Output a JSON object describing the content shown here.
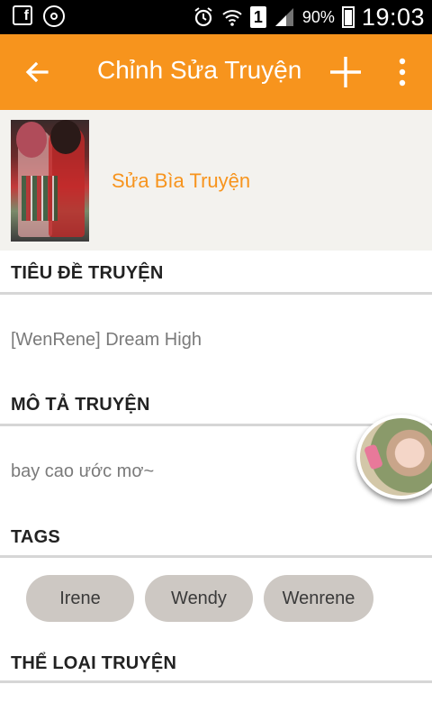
{
  "status_bar": {
    "facebook_icon": "facebook-icon",
    "browser_icon": "chrome-icon",
    "alarm_icon": "alarm-icon",
    "wifi_icon": "wifi-icon",
    "sim_label": "1",
    "signal_icon": "signal-icon",
    "battery_percent": "90%",
    "time": "19:03"
  },
  "app_bar": {
    "background": "#f7941d",
    "title": "Chỉnh Sửa Truyện",
    "back_icon": "arrow-back-icon",
    "add_icon": "plus-icon",
    "more_icon": "more-vert-icon"
  },
  "cover": {
    "edit_label": "Sửa Bìa Truyện",
    "accent": "#f7941d"
  },
  "story_title": {
    "label": "TIÊU ĐỀ TRUYỆN",
    "value": "[WenRene] Dream High"
  },
  "story_description": {
    "label": "MÔ TẢ TRUYỆN",
    "value": "bay cao ước mơ~"
  },
  "tags": {
    "label": "TAGS",
    "items": [
      "Irene",
      "Wendy",
      "Wenrene"
    ]
  },
  "genre": {
    "label": "THỂ LOẠI TRUYỆN"
  }
}
